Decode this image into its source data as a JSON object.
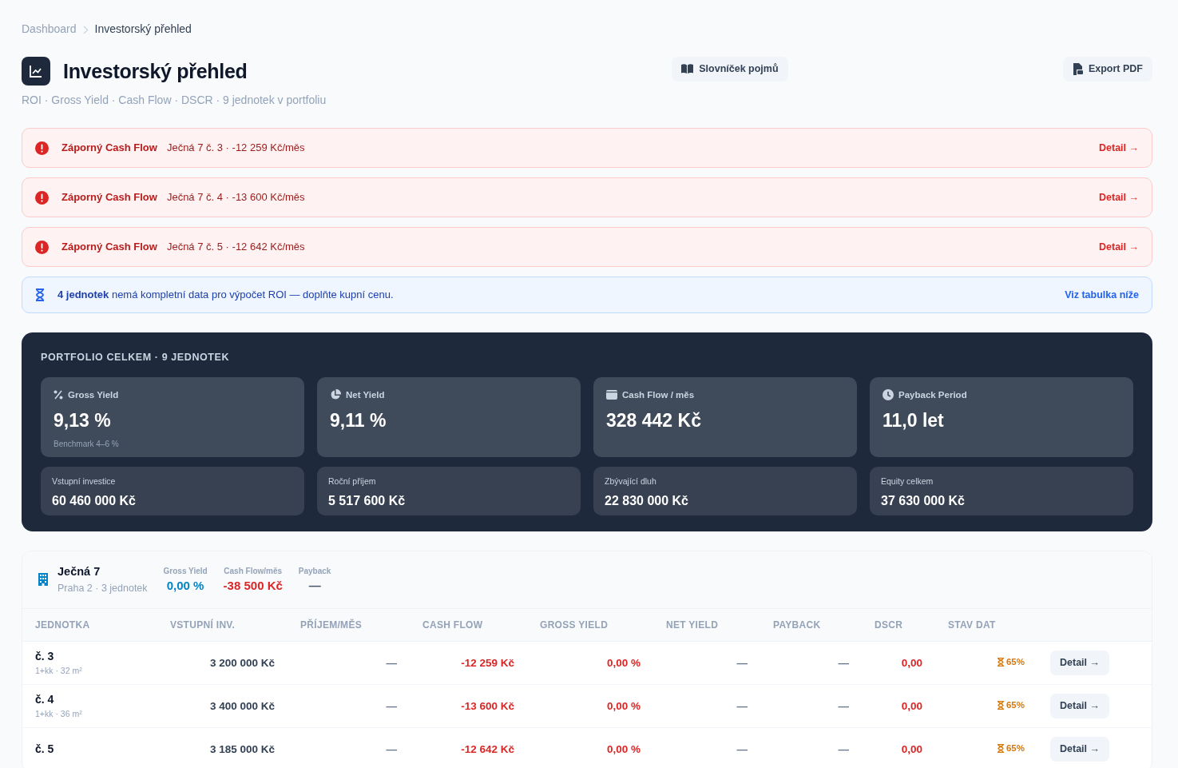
{
  "breadcrumb": [
    {
      "label": "Dashboard",
      "current": false
    },
    {
      "label": "Investorský přehled",
      "current": true
    }
  ],
  "header": {
    "title": "Investorský přehled",
    "subtitle": "ROI · Gross Yield · Cash Flow · DSCR · 9 jednotek v portfoliu",
    "buttons": [
      {
        "label": "Slovníček pojmů"
      },
      {
        "label": "Export PDF"
      }
    ]
  },
  "alerts": [
    {
      "kind": "error",
      "title": "Záporný Cash Flow",
      "text": "Ječná 7 č. 3 · -12 259 Kč/měs",
      "link": "Detail →"
    },
    {
      "kind": "error",
      "title": "Záporný Cash Flow",
      "text": "Ječná 7 č. 4 · -13 600 Kč/měs",
      "link": "Detail →"
    },
    {
      "kind": "error",
      "title": "Záporný Cash Flow",
      "text": "Ječná 7 č. 5 · -12 642 Kč/měs",
      "link": "Detail →"
    },
    {
      "kind": "info",
      "text": "**4 jednotek** nemá kompletní data pro výpočet ROI — doplňte kupní cenu.",
      "link": "Viz tabulka níže"
    }
  ],
  "portfolio": {
    "heading": "PORTFOLIO CELKEM · 9 JEDNOTEK",
    "kpis": [
      {
        "label": "Gross Yield",
        "value": "9,13 %",
        "note": "Benchmark 4–6 %"
      },
      {
        "label": "Net Yield",
        "value": "9,11 %"
      },
      {
        "label": "Cash Flow / měs",
        "value": "328 442 Kč"
      },
      {
        "label": "Payback Period",
        "value": "11,0 let"
      }
    ],
    "totals": [
      {
        "label": "Vstupní investice",
        "value": "60 460 000 Kč"
      },
      {
        "label": "Roční příjem",
        "value": "5 517 600 Kč"
      },
      {
        "label": "Zbývající dluh",
        "value": "22 830 000 Kč"
      },
      {
        "label": "Equity celkem",
        "value": "37 630 000 Kč"
      }
    ]
  },
  "building": {
    "name": "Ječná 7",
    "subtitle": "Praha 2 · 3 jednotek",
    "stats": [
      {
        "label": "Gross Yield",
        "value": "0,00 %",
        "color": "#0284c7"
      },
      {
        "label": "Cash Flow/měs",
        "value": "-38 500 Kč",
        "color": "#dc2626"
      },
      {
        "label": "Payback",
        "value": "—",
        "color": "#475569"
      }
    ],
    "table": {
      "columns": [
        "JEDNOTKA",
        "VSTUPNÍ INV.",
        "PŘÍJEM/MĚS",
        "CASH FLOW",
        "GROSS YIELD",
        "NET YIELD",
        "PAYBACK",
        "DSCR",
        "STAV DAT"
      ],
      "rows": [
        {
          "unit": "č. 3",
          "detail": "1+kk · 32 m²",
          "investment": "3 200 000 Kč",
          "income": "—",
          "cash_flow": "-12 259 Kč",
          "gross_yield": "0,00 %",
          "net_yield": "—",
          "payback": "—",
          "dscr": "0,00",
          "data_status": "65%",
          "action": "Detail →"
        },
        {
          "unit": "č. 4",
          "detail": "1+kk · 36 m²",
          "investment": "3 400 000 Kč",
          "income": "—",
          "cash_flow": "-13 600 Kč",
          "gross_yield": "0,00 %",
          "net_yield": "—",
          "payback": "—",
          "dscr": "0,00",
          "data_status": "65%",
          "action": "Detail →"
        },
        {
          "unit": "č. 5",
          "investment": "3 185 000 Kč",
          "income": "—",
          "cash_flow": "-12 642 Kč",
          "gross_yield": "0,00 %",
          "net_yield": "—",
          "payback": "—",
          "dscr": "0,00",
          "data_status": "65%",
          "action": "Detail →"
        }
      ]
    }
  }
}
